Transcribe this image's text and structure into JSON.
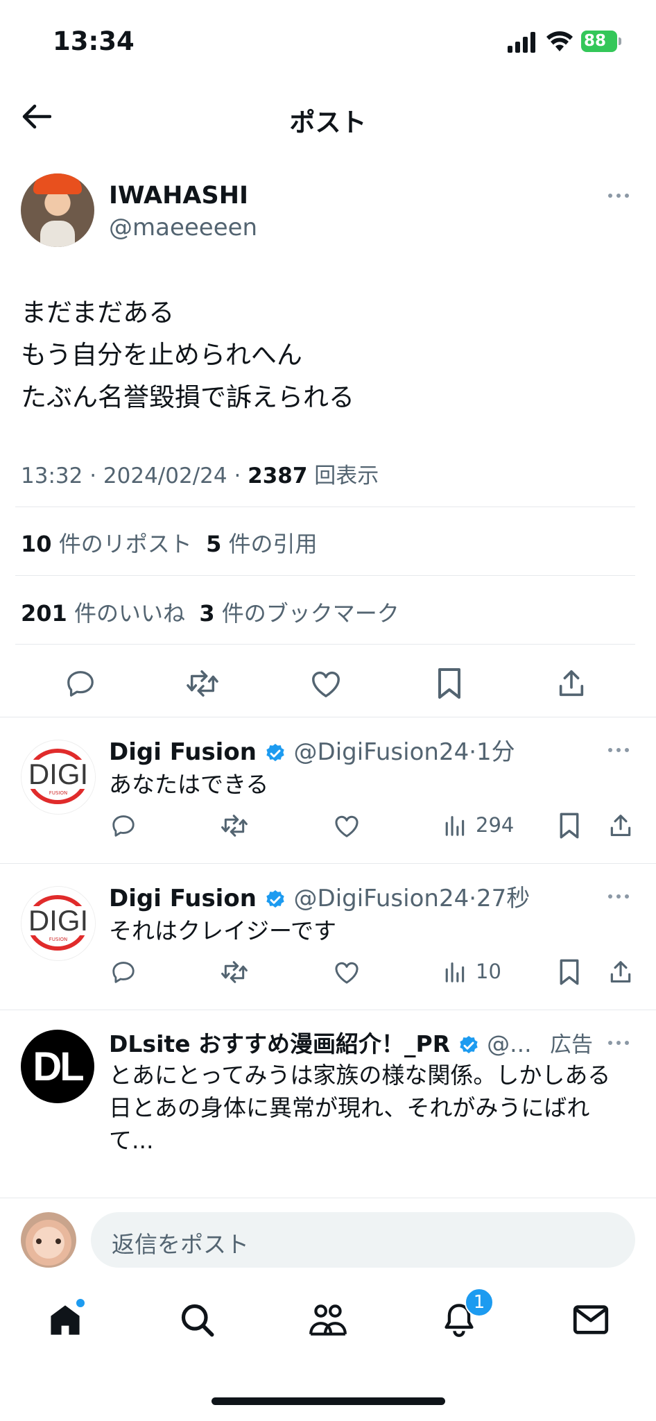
{
  "status_bar": {
    "time": "13:34",
    "battery": "88"
  },
  "header": {
    "title": "ポスト"
  },
  "post": {
    "display_name": "IWAHASHI",
    "handle": "@maeeeeen",
    "lines": [
      "まだまだある",
      "もう自分を止められへん",
      "たぶん名誉毀損で訴えられる"
    ],
    "time": "13:32",
    "date": "2024/02/24",
    "views_count": "2387",
    "views_label": "回表示",
    "reposts_count": "10",
    "reposts_label": "件のリポスト",
    "quotes_count": "5",
    "quotes_label": "件の引用",
    "likes_count": "201",
    "likes_label": "件のいいね",
    "bookmarks_count": "3",
    "bookmarks_label": "件のブックマーク"
  },
  "replies": [
    {
      "name": "Digi Fusion",
      "handle": "@DigiFusion24",
      "time": "1分",
      "text": "あなたはできる",
      "views": "294",
      "avatar_text": "DIGI",
      "avatar_sub": "FUSION"
    },
    {
      "name": "Digi Fusion",
      "handle": "@DigiFusion24",
      "time": "27秒",
      "text": "それはクレイジーです",
      "views": "10",
      "avatar_text": "DIGI",
      "avatar_sub": "FUSION"
    }
  ],
  "ad": {
    "name": "DLsite おすすめ漫画紹介！_PR",
    "handle": "@...",
    "label": "広告",
    "avatar_text": "DL",
    "lines": [
      "とあにとってみうは家族の様な関係。しかしある",
      "日とあの身体に異常が現れ、それがみうにばれ",
      "て..."
    ]
  },
  "reply_bar": {
    "placeholder": "返信をポスト"
  },
  "tab_bar": {
    "notifications_badge": "1"
  },
  "colors": {
    "accent": "#1d9bf0",
    "muted": "#536471",
    "divider": "#e6e9ec",
    "battery": "#34c759"
  }
}
